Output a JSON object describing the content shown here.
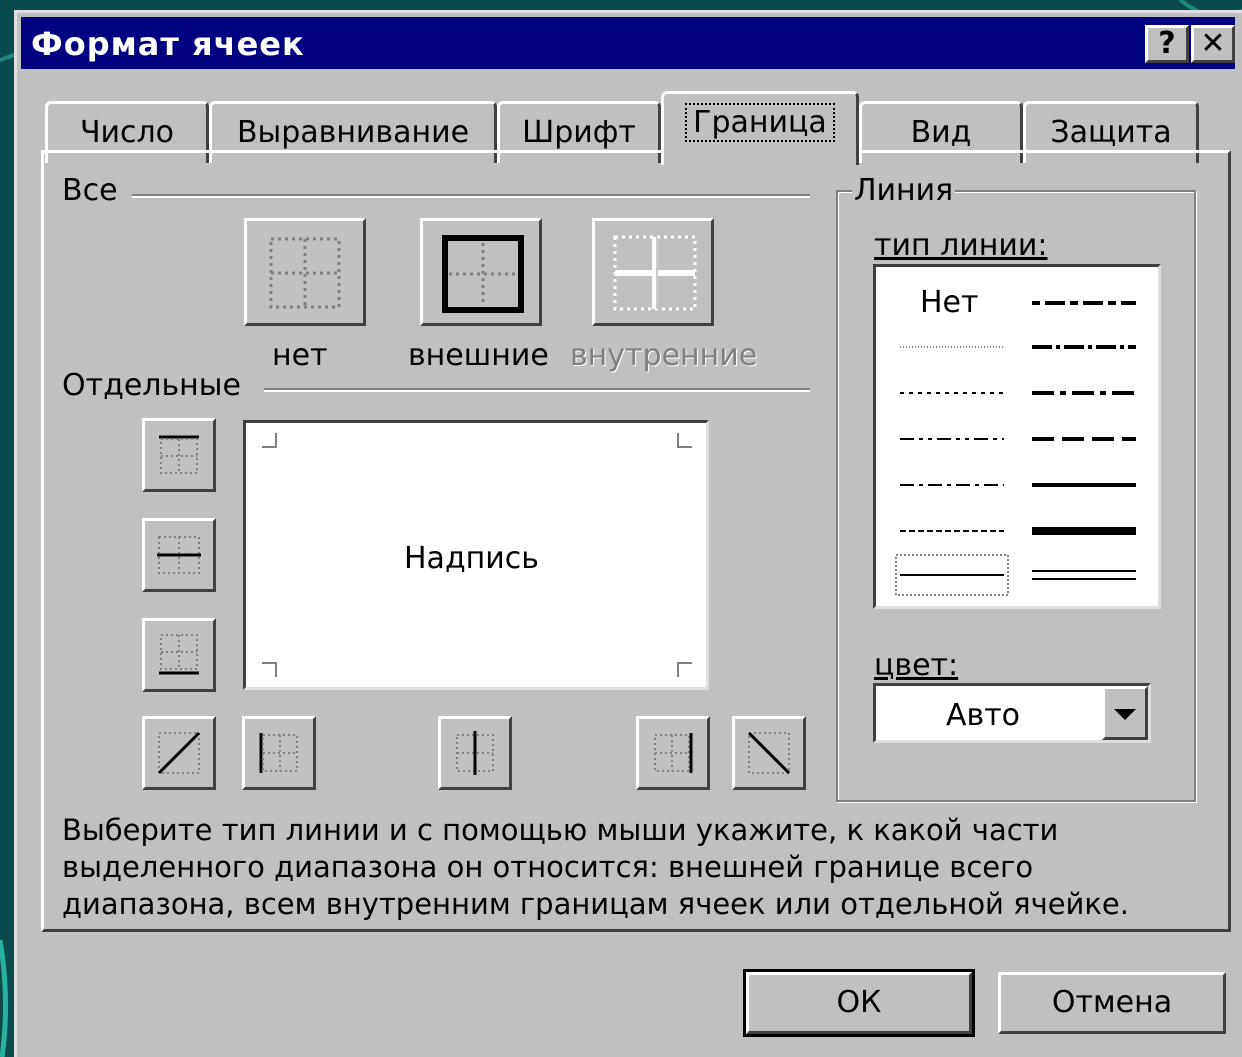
{
  "window": {
    "title": "Формат ячеек",
    "help_label": "?",
    "close_label": "✕"
  },
  "tabs": [
    {
      "label": "Число",
      "active": false
    },
    {
      "label": "Выравнивание",
      "active": false
    },
    {
      "label": "Шрифт",
      "active": false
    },
    {
      "label": "Граница",
      "active": true
    },
    {
      "label": "Вид",
      "active": false
    },
    {
      "label": "Защита",
      "active": false
    }
  ],
  "all": {
    "group_label": "Все",
    "presets": [
      {
        "label": "нет",
        "icon": "border-none-icon",
        "enabled": true
      },
      {
        "label": "внешние",
        "icon": "border-outline-icon",
        "enabled": true
      },
      {
        "label": "внутренние",
        "icon": "border-inside-icon",
        "enabled": false
      }
    ]
  },
  "individual": {
    "group_label": "Отдельные",
    "preview_text": "Надпись"
  },
  "line": {
    "group_label": "Линия",
    "style_label": "тип линии:",
    "none_label": "Нет",
    "color_label": "цвет:",
    "color_value": "Авто"
  },
  "description": [
    "Выберите тип линии и с помощью мыши укажите, к какой части",
    "выделенного диапазона он относится: внешней границе всего",
    "диапазона, всем внутренним границам ячеек или отдельной ячейке."
  ],
  "buttons": {
    "ok": "ОК",
    "cancel": "Отмена"
  },
  "colors": {
    "titlebar": "#000080",
    "face": "#c0c0c0",
    "background": "#0b4a4c"
  }
}
